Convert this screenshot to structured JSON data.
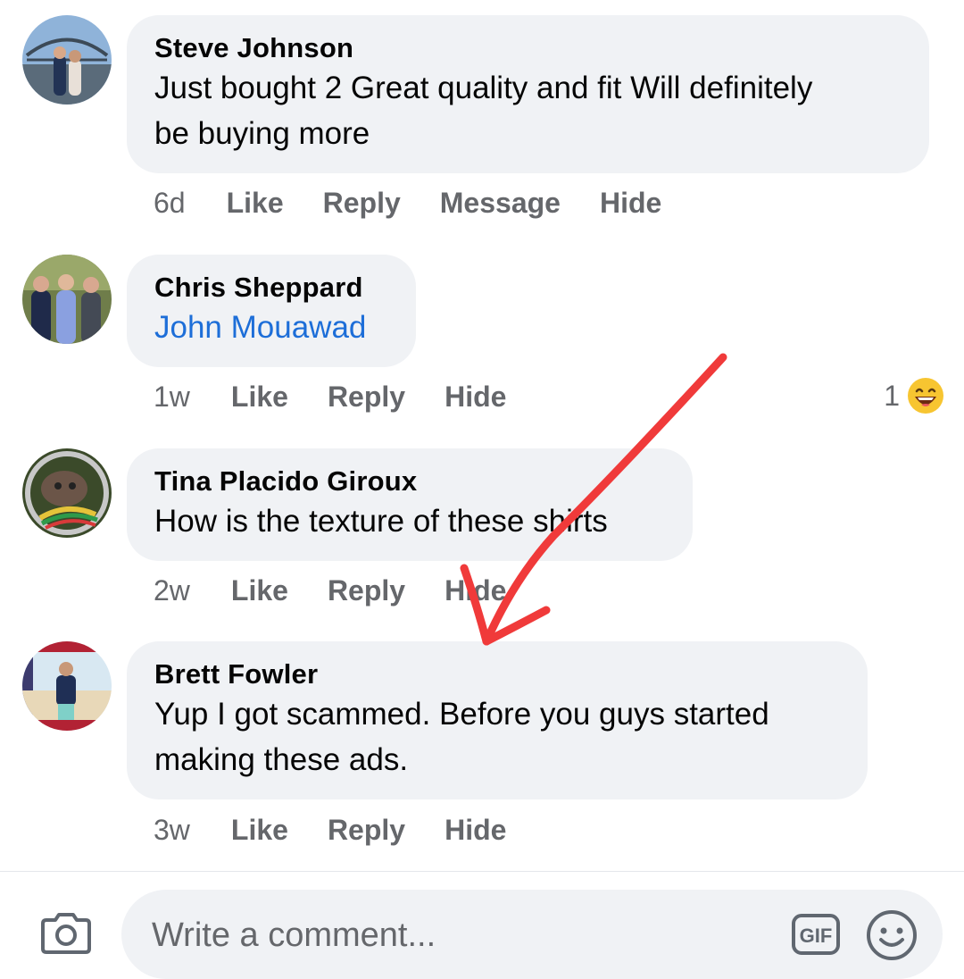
{
  "comments": [
    {
      "author": "Steve Johnson",
      "text_lines": [
        "Just bought 2 Great quality and fit Will definitely",
        "be buying more"
      ],
      "time": "6d",
      "actions": [
        "Like",
        "Reply",
        "Message",
        "Hide"
      ]
    },
    {
      "author": "Chris Sheppard",
      "mention": "John Mouawad",
      "time": "1w",
      "actions": [
        "Like",
        "Reply",
        "Hide"
      ],
      "reaction": {
        "count": "1",
        "icon": "laughing-emoji-icon"
      }
    },
    {
      "author": "Tina Placido Giroux",
      "text_lines": [
        "How is the texture of these shirts"
      ],
      "time": "2w",
      "actions": [
        "Like",
        "Reply",
        "Hide"
      ]
    },
    {
      "author": "Brett Fowler",
      "text_lines": [
        "Yup I got scammed. Before you guys started",
        "making these ads."
      ],
      "time": "3w",
      "actions": [
        "Like",
        "Reply",
        "Hide"
      ]
    }
  ],
  "composer": {
    "placeholder": "Write a comment...",
    "gif_label": "GIF",
    "icons": [
      "camera-icon",
      "gif-icon",
      "emoji-icon"
    ]
  },
  "colors": {
    "bubble_bg": "#f0f2f5",
    "secondary_text": "#65676b",
    "link": "#1d6ed8",
    "annotation_arrow": "#f03a3a"
  }
}
